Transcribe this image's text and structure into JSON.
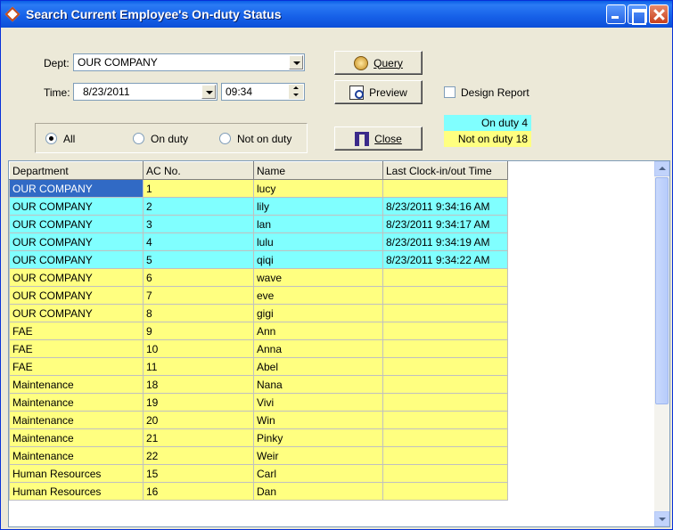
{
  "window": {
    "title": "Search Current Employee's On-duty Status"
  },
  "filters": {
    "dept_label": "Dept:",
    "dept_value": "OUR COMPANY",
    "time_label": "Time:",
    "date_value": "8/23/2011",
    "time_value": "09:34"
  },
  "buttons": {
    "query_label": "Query",
    "preview_label": "Preview",
    "close_label": "Close"
  },
  "design_report_label": "Design Report",
  "radios": {
    "all": "All",
    "on_duty": "On duty",
    "not_on_duty": "Not on duty",
    "selected": "all"
  },
  "legend": {
    "on_duty_label": "On duty",
    "on_duty_count": "4",
    "not_on_duty_label": "Not on duty",
    "not_on_duty_count": "18",
    "on_color": "#80ffff",
    "off_color": "#ffff80"
  },
  "table": {
    "columns": [
      "Department",
      "AC No.",
      "Name",
      "Last Clock-in/out Time"
    ],
    "rows": [
      {
        "dept": "OUR COMPANY",
        "ac": "1",
        "name": "lucy",
        "time": "",
        "status": "off"
      },
      {
        "dept": "OUR COMPANY",
        "ac": "2",
        "name": "lily",
        "time": "8/23/2011 9:34:16 AM",
        "status": "on"
      },
      {
        "dept": "OUR COMPANY",
        "ac": "3",
        "name": "lan",
        "time": "8/23/2011 9:34:17 AM",
        "status": "on"
      },
      {
        "dept": "OUR COMPANY",
        "ac": "4",
        "name": "lulu",
        "time": "8/23/2011 9:34:19 AM",
        "status": "on"
      },
      {
        "dept": "OUR COMPANY",
        "ac": "5",
        "name": "qiqi",
        "time": "8/23/2011 9:34:22 AM",
        "status": "on"
      },
      {
        "dept": "OUR COMPANY",
        "ac": "6",
        "name": "wave",
        "time": "",
        "status": "off"
      },
      {
        "dept": "OUR COMPANY",
        "ac": "7",
        "name": "eve",
        "time": "",
        "status": "off"
      },
      {
        "dept": "OUR COMPANY",
        "ac": "8",
        "name": "gigi",
        "time": "",
        "status": "off"
      },
      {
        "dept": "FAE",
        "ac": "9",
        "name": "Ann",
        "time": "",
        "status": "off"
      },
      {
        "dept": "FAE",
        "ac": "10",
        "name": "Anna",
        "time": "",
        "status": "off"
      },
      {
        "dept": "FAE",
        "ac": "11",
        "name": "Abel",
        "time": "",
        "status": "off"
      },
      {
        "dept": "Maintenance",
        "ac": "18",
        "name": "Nana",
        "time": "",
        "status": "off"
      },
      {
        "dept": "Maintenance",
        "ac": "19",
        "name": "Vivi",
        "time": "",
        "status": "off"
      },
      {
        "dept": "Maintenance",
        "ac": "20",
        "name": "Win",
        "time": "",
        "status": "off"
      },
      {
        "dept": "Maintenance",
        "ac": "21",
        "name": "Pinky",
        "time": "",
        "status": "off"
      },
      {
        "dept": "Maintenance",
        "ac": "22",
        "name": "Weir",
        "time": "",
        "status": "off"
      },
      {
        "dept": "Human Resources",
        "ac": "15",
        "name": "Carl",
        "time": "",
        "status": "off"
      },
      {
        "dept": "Human Resources",
        "ac": "16",
        "name": "Dan",
        "time": "",
        "status": "off"
      }
    ]
  },
  "icons": {
    "title": "app-diamond-icon",
    "query": "magnifier-icon",
    "preview": "preview-page-icon",
    "close": "door-icon"
  }
}
